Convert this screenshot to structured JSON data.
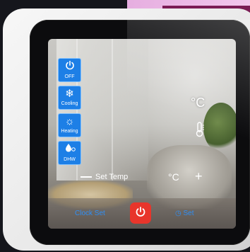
{
  "modes": [
    {
      "icon": "power-icon",
      "label": "OFF"
    },
    {
      "icon": "snowflake-icon",
      "label": "Cooling"
    },
    {
      "icon": "sun-icon",
      "label": "Heating"
    },
    {
      "icon": "water-drop-icon",
      "label": "DHW"
    }
  ],
  "status": {
    "temp_unit": "°C"
  },
  "set_temp": {
    "label": "Set Temp",
    "unit": "°C",
    "minus": "—",
    "plus": "+"
  },
  "bottom": {
    "clock_label": "Clock Set",
    "timer_label": "Set"
  },
  "colors": {
    "mode_button": "#1d7fe6",
    "power_button": "#e8352b",
    "link_text": "#2f8ef5"
  }
}
